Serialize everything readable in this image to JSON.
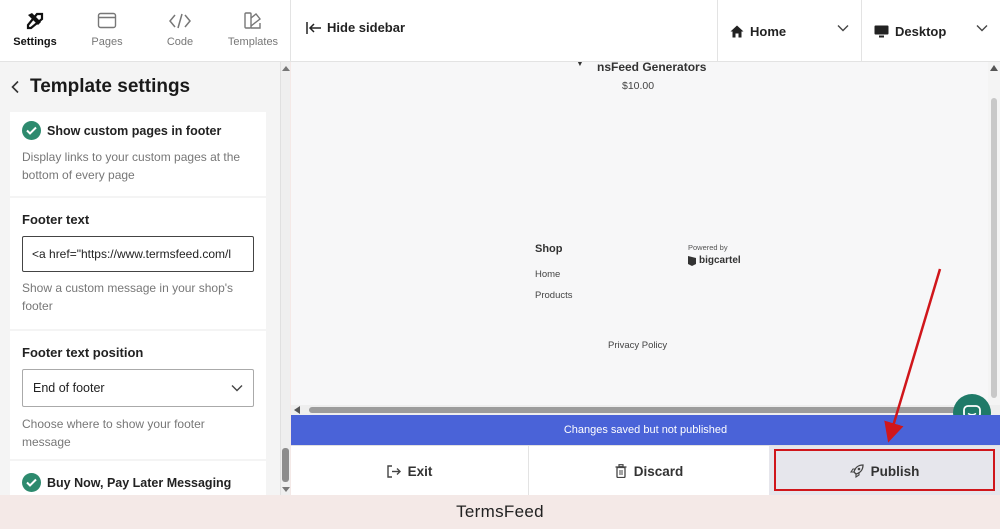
{
  "nav": {
    "tabs": [
      {
        "label": "Settings",
        "icon": "tools-icon",
        "active": true
      },
      {
        "label": "Pages",
        "icon": "pages-icon"
      },
      {
        "label": "Code",
        "icon": "code-icon"
      },
      {
        "label": "Templates",
        "icon": "templates-icon"
      }
    ]
  },
  "toolbar": {
    "hide_sidebar": "Hide sidebar",
    "page_select": "Home",
    "device_select": "Desktop"
  },
  "sidebar": {
    "title": "Template settings",
    "custom_pages": {
      "label": "Show custom pages in footer",
      "help": "Display links to your custom pages at the bottom of every page",
      "checked": true
    },
    "footer_text": {
      "label": "Footer text",
      "value": "<a href=\"https://www.termsfeed.com/l",
      "help": "Show a custom message in your shop's footer"
    },
    "footer_position": {
      "label": "Footer text position",
      "value": "End of footer",
      "help": "Choose where to show your footer message"
    },
    "bnpl": {
      "label": "Buy Now, Pay Later Messaging",
      "checked": true
    }
  },
  "preview": {
    "product_name": "nsFeed Generators",
    "product_price": "$10.00",
    "shop_heading": "Shop",
    "shop_links": [
      "Home",
      "Products"
    ],
    "powered_by": "Powered by",
    "brand": "bigcartel",
    "privacy_link": "Privacy Policy"
  },
  "status": {
    "message": "Changes saved but not published"
  },
  "actions": {
    "exit": "Exit",
    "discard": "Discard",
    "publish": "Publish"
  },
  "watermark": "TermsFeed",
  "colors": {
    "accent_green": "#2d8a6e",
    "status_blue": "#4a63d8",
    "highlight_red": "#d0161b",
    "chat_teal": "#1f7a68"
  }
}
